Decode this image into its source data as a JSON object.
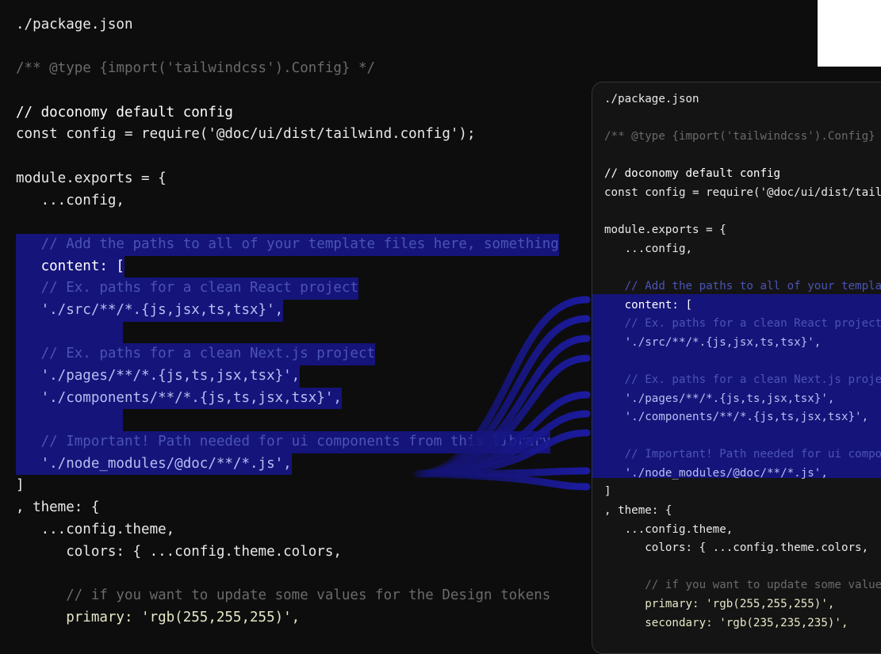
{
  "left_editor": {
    "lines": [
      "./package.json",
      "",
      "/** @type {import('tailwindcss').Config} */",
      "",
      "// doconomy default config",
      "const config = require('@doc/ui/dist/tailwind.config');",
      "",
      "module.exports = {",
      "   ...config,",
      "",
      "   // Add the paths to all of your template files here, something",
      "   content: [",
      "   // Ex. paths for a clean React project",
      "   './src/**/*.{js,jsx,ts,tsx}',",
      "",
      "   // Ex. paths for a clean Next.js project",
      "   './pages/**/*.{js,ts,jsx,tsx}',",
      "   './components/**/*.{js,ts,jsx,tsx}',",
      "",
      "   // Important! Path needed for ui components from this library",
      "   './node_modules/@doc/**/*.js',",
      "]",
      ", theme: {",
      "   ...config.theme,",
      "      colors: { ...config.theme.colors,",
      "",
      "      // if you want to update some values for the Design tokens",
      "      primary: 'rgb(255,255,255)',"
    ]
  },
  "right_editor": {
    "lines": [
      "./package.json",
      "",
      "/** @type {import('tailwindcss').Config} */",
      "",
      "// doconomy default config",
      "const config = require('@doc/ui/dist/tailwind.config');",
      "",
      "module.exports = {",
      "   ...config,",
      "",
      "   // Add the paths to all of your template files here",
      "   content: [",
      "   // Ex. paths for a clean React project",
      "   './src/**/*.{js,jsx,ts,tsx}',",
      "",
      "   // Ex. paths for a clean Next.js project",
      "   './pages/**/*.{js,ts,jsx,tsx}',",
      "   './components/**/*.{js,ts,jsx,tsx}',",
      "",
      "   // Important! Path needed for ui components",
      "   './node_modules/@doc/**/*.js',",
      "]",
      ", theme: {",
      "   ...config.theme,",
      "      colors: { ...config.theme.colors,",
      "",
      "      // if you want to update some values",
      "      primary: 'rgb(255,255,255)',",
      "      secondary: 'rgb(235,235,235)',"
    ]
  },
  "colors": {
    "background": "#0d0d0d",
    "highlight": "#15147a",
    "panel": "#141414"
  }
}
